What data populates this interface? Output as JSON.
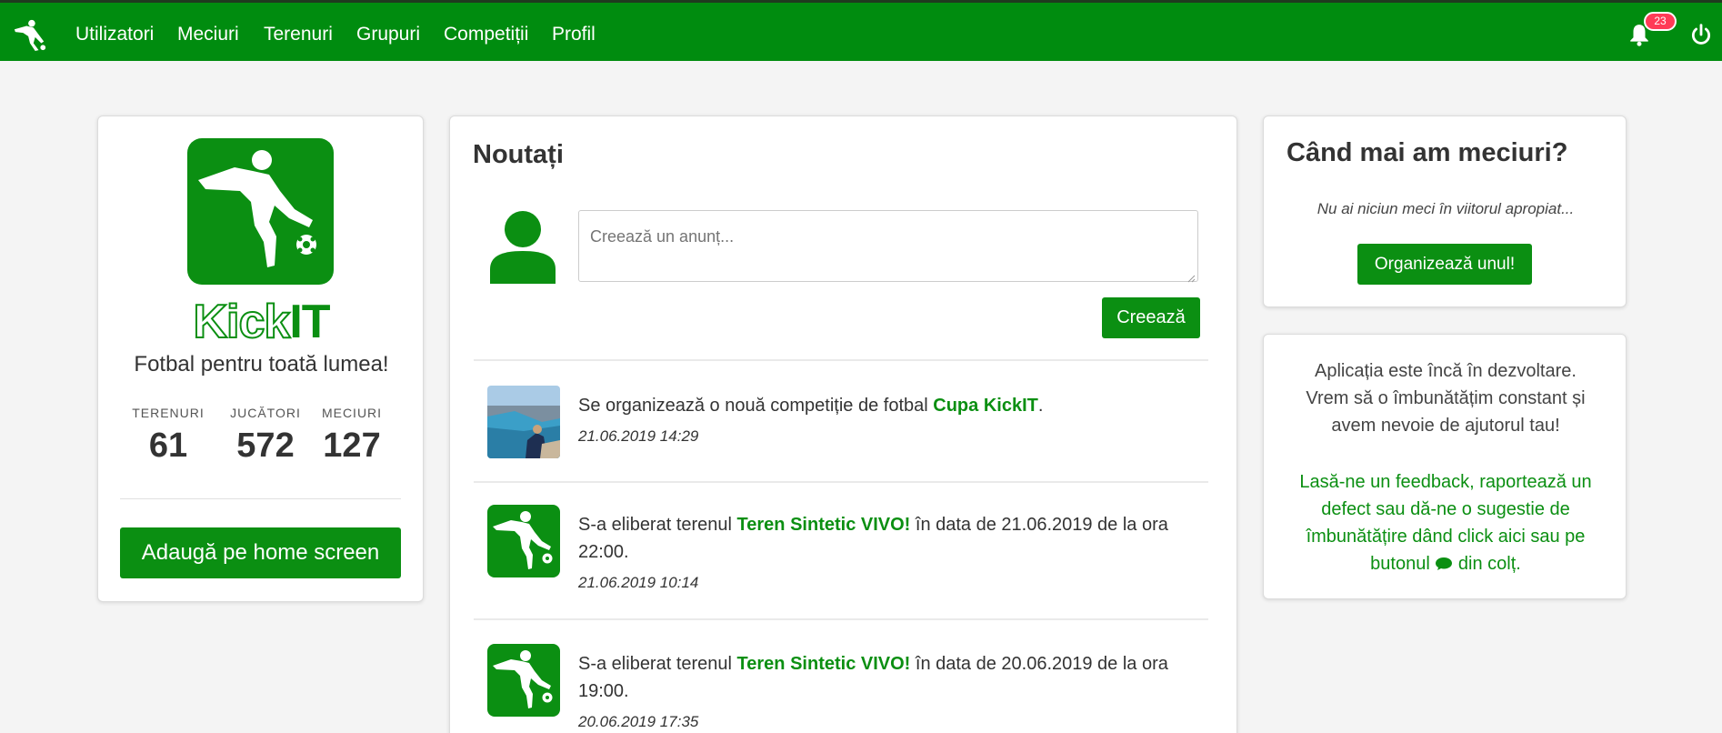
{
  "nav": {
    "items": [
      {
        "label": "Utilizatori"
      },
      {
        "label": "Meciuri"
      },
      {
        "label": "Terenuri"
      },
      {
        "label": "Grupuri"
      },
      {
        "label": "Competiții"
      },
      {
        "label": "Profil"
      }
    ],
    "notifications_count": "23"
  },
  "left": {
    "logo_kick": "Kick",
    "logo_it": "IT",
    "tagline": "Fotbal pentru toată lumea!",
    "stats": [
      {
        "label": "TERENURI",
        "value": "61"
      },
      {
        "label": "JUCĂTORI",
        "value": "572"
      },
      {
        "label": "MECIURI",
        "value": "127"
      }
    ],
    "home_button": "Adaugă pe home screen"
  },
  "news": {
    "title": "Noutați",
    "placeholder": "Creează un anunț...",
    "create_button": "Creează",
    "items": [
      {
        "text_before": "Se organizează o nouă competiție de fotbal ",
        "highlight": "Cupa KickIT",
        "text_after": ".",
        "date": "21.06.2019 14:29",
        "thumb": "landscape-photo"
      },
      {
        "text_before": "S-a eliberat terenul ",
        "highlight": "Teren Sintetic VIVO!",
        "text_after": " în data de 21.06.2019 de la ora 22:00.",
        "date": "21.06.2019 10:14",
        "thumb": "kickit-logo"
      },
      {
        "text_before": "S-a eliberat terenul ",
        "highlight": "Teren Sintetic VIVO!",
        "text_after": " în data de 20.06.2019 de la ora 19:00.",
        "date": "20.06.2019 17:35",
        "thumb": "kickit-logo"
      }
    ]
  },
  "matches": {
    "title": "Când mai am meciuri?",
    "message": "Nu ai niciun meci în viitorul apropiat...",
    "button": "Organizează unul!"
  },
  "feedback": {
    "text": "Aplicația este încă în dezvoltare. Vrem să o îmbunătățim constant și avem nevoie de ajutorul tau!",
    "link_before": "Lasă-ne un feedback, raportează un defect sau dă-ne o sugestie de îmbunătățire dând click aici sau pe butonul",
    "link_after": "din colț."
  },
  "colors": {
    "brand_green": "#008c0f",
    "badge_red": "#ff3b57",
    "background": "#f4f4f4"
  }
}
